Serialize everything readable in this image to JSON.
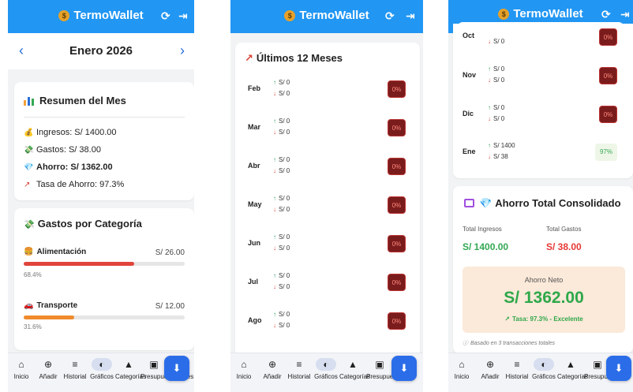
{
  "app": {
    "title": "TermoWallet",
    "coin_glyph": "$",
    "refresh_icon": "refresh-icon",
    "logout_icon": "logout-icon"
  },
  "panel1": {
    "month": "Enero 2026",
    "summary": {
      "title": "Resumen del Mes",
      "ingresos": "Ingresos: S/ 1400.00",
      "gastos": "Gastos: S/ 38.00",
      "ahorro": "Ahorro: S/ 1362.00",
      "tasa": "Tasa de Ahorro: 97.3%"
    },
    "categories": {
      "title": "Gastos por Categoría",
      "items": [
        {
          "label": "Alimentación",
          "amount": "S/ 26.00",
          "percent_label": "68.4%",
          "percent": 68.4,
          "color": "#e0443c"
        },
        {
          "label": "Transporte",
          "amount": "S/ 12.00",
          "percent_label": "31.6%",
          "percent": 31.6,
          "color": "#f08a2c"
        }
      ]
    }
  },
  "panel2": {
    "title": "Últimos 12 Meses",
    "months": [
      {
        "name": "Feb",
        "income": "S/ 0",
        "expense": "S/ 0",
        "rate": "0%"
      },
      {
        "name": "Mar",
        "income": "S/ 0",
        "expense": "S/ 0",
        "rate": "0%"
      },
      {
        "name": "Abr",
        "income": "S/ 0",
        "expense": "S/ 0",
        "rate": "0%"
      },
      {
        "name": "May",
        "income": "S/ 0",
        "expense": "S/ 0",
        "rate": "0%"
      },
      {
        "name": "Jun",
        "income": "S/ 0",
        "expense": "S/ 0",
        "rate": "0%"
      },
      {
        "name": "Jul",
        "income": "S/ 0",
        "expense": "S/ 0",
        "rate": "0%"
      },
      {
        "name": "Ago",
        "income": "S/ 0",
        "expense": "S/ 0",
        "rate": "0%"
      }
    ]
  },
  "panel3": {
    "months": [
      {
        "name": "Oct",
        "income": "",
        "expense": "S/ 0",
        "rate": "0%"
      },
      {
        "name": "Nov",
        "income": "S/ 0",
        "expense": "S/ 0",
        "rate": "0%"
      },
      {
        "name": "Dic",
        "income": "S/ 0",
        "expense": "S/ 0",
        "rate": "0%"
      },
      {
        "name": "Ene",
        "income": "S/ 1400",
        "expense": "S/ 38",
        "rate": "97%"
      }
    ],
    "consolidated": {
      "title": "Ahorro Total Consolidado",
      "total_ingresos_label": "Total Ingresos",
      "total_gastos_label": "Total Gastos",
      "total_ingresos": "S/ 1400.00",
      "total_gastos": "S/ 38.00",
      "neto_label": "Ahorro Neto",
      "neto_value": "S/ 1362.00",
      "tasa": "Tasa: 97.3% - Excelente",
      "footnote": "Basado en 3 transacciones totales"
    }
  },
  "nav": {
    "inicio": "Inicio",
    "anadir": "Añadir",
    "historial": "Historial",
    "graficos": "Gráficos",
    "categorias": "Categorías",
    "presupuesto": "Presupuesto",
    "reportes": "Reportes",
    "download_icon": "download-icon"
  },
  "colors": {
    "primary": "#2196f3",
    "income_green": "#34a853",
    "expense_red": "#e53935",
    "badge_dark": "#7a1c1c"
  }
}
